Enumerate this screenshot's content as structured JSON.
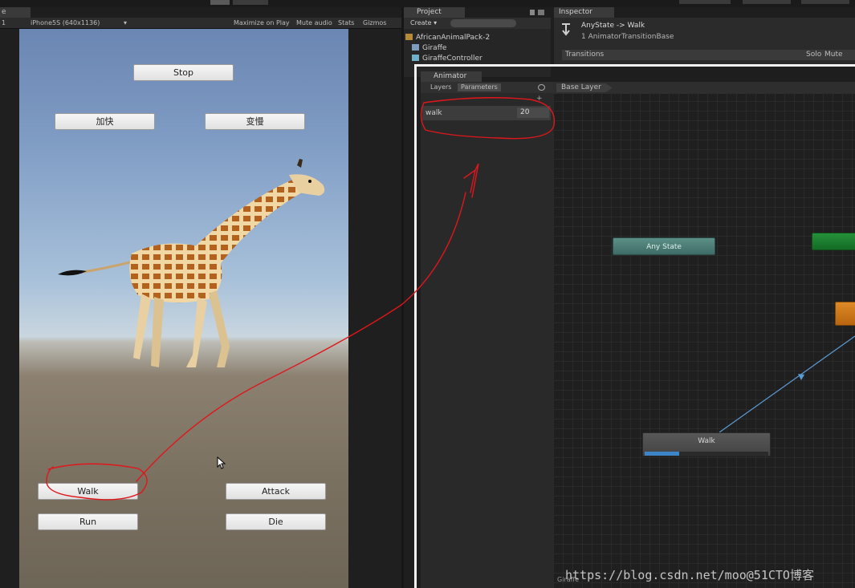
{
  "game_view": {
    "tab_label": "e",
    "toolbar": {
      "display_index": "1",
      "resolution": "iPhone5S (640x1136)",
      "dropdown_arrow": "▾",
      "maximize_on_play": "Maximize on Play",
      "mute_audio": "Mute audio",
      "stats": "Stats",
      "gizmos": "Gizmos"
    },
    "buttons": {
      "stop": "Stop",
      "speed_up": "加快",
      "slow_down": "变慢",
      "walk": "Walk",
      "attack": "Attack",
      "run": "Run",
      "die": "Die"
    }
  },
  "project": {
    "tab_label": "Project",
    "create_label": "Create ▾",
    "items": [
      {
        "label": "AfricanAnimalPack-2",
        "icon": "folder-icon"
      },
      {
        "label": "Giraffe",
        "icon": "prefab-icon"
      },
      {
        "label": "GiraffeController",
        "icon": "animator-controller-icon"
      }
    ]
  },
  "inspector": {
    "tab_label": "Inspector",
    "title": "AnyState -> Walk",
    "subtitle": "1 AnimatorTransitionBase",
    "transitions_label": "Transitions",
    "solo_label": "Solo",
    "mute_label": "Mute"
  },
  "animator": {
    "tab_label": "Animator",
    "left_tabs": {
      "layers": "Layers",
      "parameters": "Parameters"
    },
    "parameter": {
      "name": "walk",
      "value": "20"
    },
    "breadcrumb": "Base Layer",
    "nodes": {
      "any_state": "Any State",
      "walk": "Walk",
      "walk_progress": 0.28
    },
    "footer": "Giraffe"
  },
  "watermark": "https://blog.csdn.net/moo@51CTO博客",
  "colors": {
    "annotation_red": "#e0161b",
    "any_state_teal": "#4a7d76",
    "entry_green": "#1f8a33",
    "state_orange": "#d07a1c",
    "progress_blue": "#3c85c9"
  }
}
